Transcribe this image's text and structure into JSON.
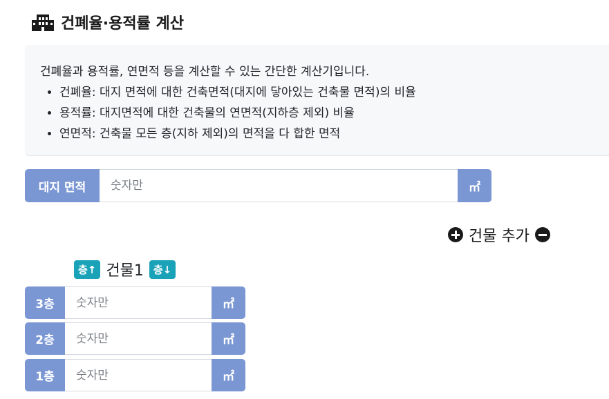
{
  "header": {
    "title": "건폐율·용적률 계산",
    "icon": "building-icon"
  },
  "info": {
    "intro": "건폐율과 용적률, 연면적 등을 계산할 수 있는 간단한 계산기입니다.",
    "items": [
      "건폐율: 대지 면적에 대한 건축면적(대지에 닿아있는 건축물 면적)의 비율",
      "용적률: 대지면적에 대한 건축물의 연면적(지하층 제외) 비율",
      "연면적: 건축물 모든 층(지하 제외)의 면적을 다 합한 면적"
    ]
  },
  "site": {
    "label": "대지 면적",
    "placeholder": "숫자만",
    "value": "",
    "unit": "㎡"
  },
  "building_controls": {
    "label": "건물 추가",
    "add_icon": "plus-circle-icon",
    "remove_icon": "minus-circle-icon"
  },
  "building": {
    "name": "건물1",
    "floor_up": "층↑",
    "floor_down": "층↓",
    "floors": [
      {
        "label": "3층",
        "placeholder": "숫자만",
        "value": "",
        "unit": "㎡"
      },
      {
        "label": "2층",
        "placeholder": "숫자만",
        "value": "",
        "unit": "㎡"
      },
      {
        "label": "1층",
        "placeholder": "숫자만",
        "value": "",
        "unit": "㎡"
      }
    ]
  },
  "colors": {
    "addon_bg": "#7b97d3",
    "badge_bg": "#1aa2b8",
    "info_bg": "#f7f8f9"
  }
}
